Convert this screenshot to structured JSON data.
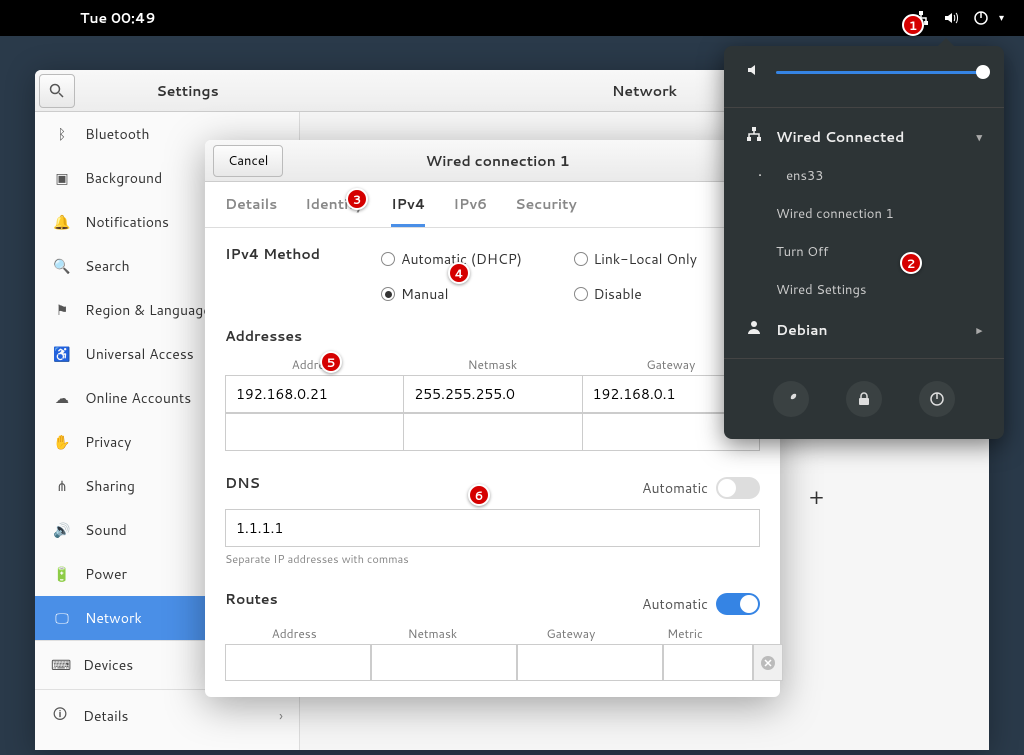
{
  "topbar": {
    "time": "Tue 00:49"
  },
  "settings_window": {
    "sidebar_title": "Settings",
    "main_title": "Network",
    "sidebar_items": [
      {
        "icon": "bluetooth",
        "label": "Bluetooth"
      },
      {
        "icon": "background",
        "label": "Background"
      },
      {
        "icon": "notifications",
        "label": "Notifications"
      },
      {
        "icon": "search",
        "label": "Search"
      },
      {
        "icon": "region",
        "label": "Region & Language"
      },
      {
        "icon": "universal",
        "label": "Universal Access"
      },
      {
        "icon": "online",
        "label": "Online Accounts"
      },
      {
        "icon": "privacy",
        "label": "Privacy"
      },
      {
        "icon": "sharing",
        "label": "Sharing"
      },
      {
        "icon": "sound",
        "label": "Sound"
      },
      {
        "icon": "power",
        "label": "Power"
      },
      {
        "icon": "network",
        "label": "Network",
        "active": true
      },
      {
        "icon": "devices",
        "label": "Devices",
        "expandable": true
      },
      {
        "icon": "details",
        "label": "Details",
        "expandable": true
      }
    ]
  },
  "dialog": {
    "cancel": "Cancel",
    "title": "Wired connection 1",
    "tabs": [
      "Details",
      "Identity",
      "IPv4",
      "IPv6",
      "Security"
    ],
    "active_tab": "IPv4",
    "method_label": "IPv4 Method",
    "methods": {
      "auto": "Automatic (DHCP)",
      "link": "Link-Local Only",
      "manual": "Manual",
      "disable": "Disable"
    },
    "selected_method": "manual",
    "addresses_label": "Addresses",
    "address_cols": {
      "addr": "Address",
      "mask": "Netmask",
      "gw": "Gateway"
    },
    "addresses": [
      {
        "addr": "192.168.0.21",
        "mask": "255.255.255.0",
        "gw": "192.168.0.1"
      },
      {
        "addr": "",
        "mask": "",
        "gw": ""
      }
    ],
    "dns_label": "DNS",
    "dns_auto_label": "Automatic",
    "dns_value": "1.1.1.1",
    "dns_hint": "Separate IP addresses with commas",
    "routes_label": "Routes",
    "routes_auto_label": "Automatic",
    "route_cols": {
      "addr": "Address",
      "mask": "Netmask",
      "gw": "Gateway",
      "metric": "Metric"
    }
  },
  "sys_menu": {
    "wired_header": "Wired Connected",
    "wired_if": "ens33",
    "wired_conn": "Wired connection 1",
    "turn_off": "Turn Off",
    "wired_settings": "Wired Settings",
    "user": "Debian"
  },
  "annotations": {
    "b1": "1",
    "b2": "2",
    "b3": "3",
    "b4": "4",
    "b5": "5",
    "b6": "6"
  }
}
